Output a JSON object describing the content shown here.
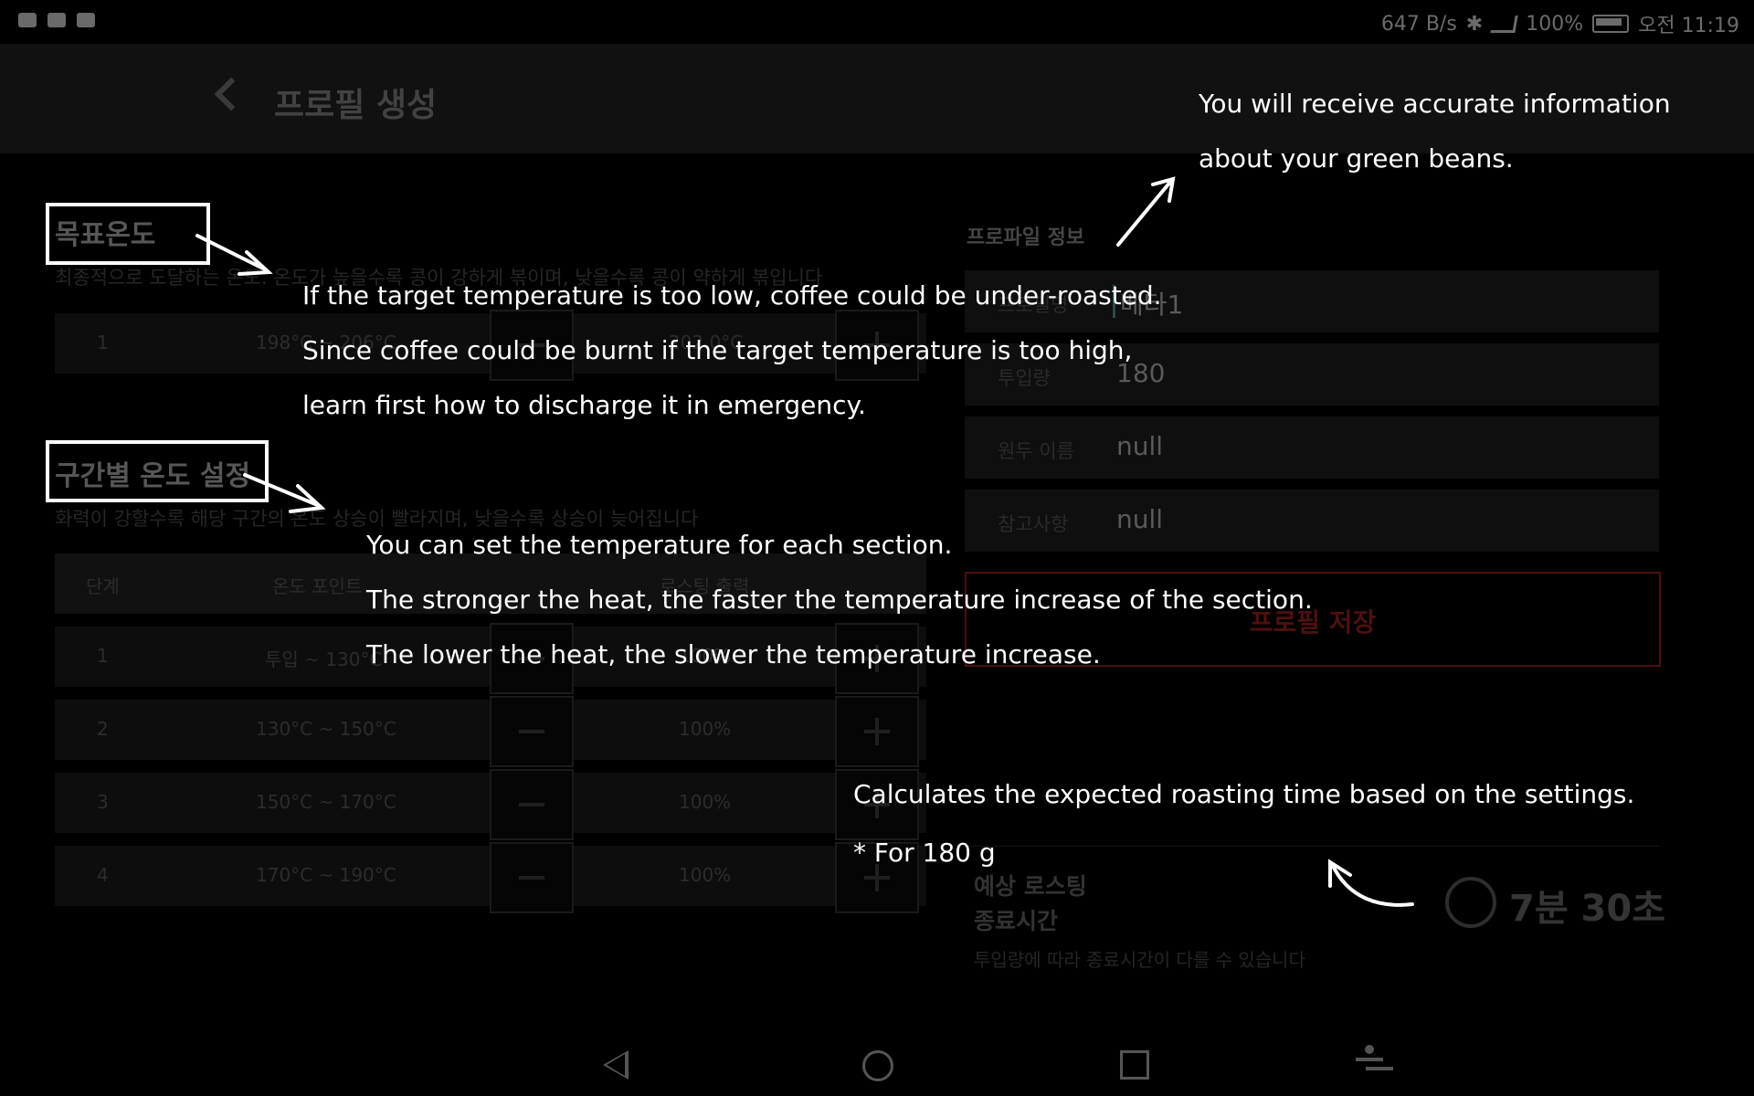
{
  "status_bar": {
    "net_speed": "647 B/s",
    "battery": "100%",
    "time": "오전 11:19"
  },
  "app_bar": {
    "title": "프로필 생성"
  },
  "target_temp": {
    "title": "목표온도",
    "desc": "최종적으로 도달하는 온도. 온도가 높을수록 콩이 강하게 볶이며, 낮을수록 콩이 약하게 볶입니다",
    "row": {
      "step": "1",
      "range": "198°C ~ 206°C",
      "value": "202.0°C"
    }
  },
  "section_temp": {
    "title": "구간별 온도 설정",
    "desc": "화력이 강할수록 해당 구간의 온도 상승이 빨라지며, 낮을수록 상승이 늦어집니다",
    "headers": [
      "단계",
      "온도 포인트",
      "로스팅 출력"
    ],
    "rows": [
      {
        "step": "1",
        "range": "투입 ~ 130°C",
        "power": "100%"
      },
      {
        "step": "2",
        "range": "130°C ~ 150°C",
        "power": "100%"
      },
      {
        "step": "3",
        "range": "150°C ~ 170°C",
        "power": "100%"
      },
      {
        "step": "4",
        "range": "170°C ~ 190°C",
        "power": "100%"
      }
    ]
  },
  "profile_info": {
    "title": "프로파일 정보",
    "fields": [
      {
        "label": "프로필명",
        "value": "베타1"
      },
      {
        "label": "투입량",
        "value": "180"
      },
      {
        "label": "원두 이름",
        "value": "null"
      },
      {
        "label": "참고사항",
        "value": "null"
      }
    ],
    "save_label": "프로필 저장"
  },
  "eta": {
    "label": "예상 로스팅\n종료시간",
    "note": "투입량에 따라 종료시간이 다를 수 있습니다",
    "time": "7분 30초"
  },
  "callouts": {
    "green_beans": [
      "You will receive accurate information",
      "about your green beans."
    ],
    "target": [
      "If the target temperature is too low, coffee could be under-roasted.",
      "Since coffee could be burnt if the target temperature is too high,",
      "learn first how to discharge it in emergency."
    ],
    "section": [
      "You can set the temperature for each section.",
      "The stronger the heat, the faster the temperature increase of the section.",
      "The lower the heat, the slower the temperature increase."
    ],
    "eta": [
      "Calculates the expected roasting time based on the settings.",
      "* For 180 g"
    ]
  }
}
